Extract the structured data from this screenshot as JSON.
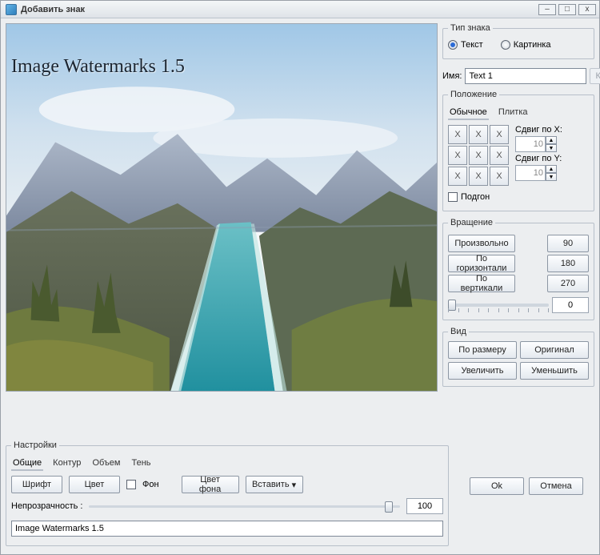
{
  "window": {
    "title": "Добавить знак"
  },
  "preview": {
    "watermark_text": "Image Watermarks 1.5"
  },
  "type": {
    "legend": "Тип знака",
    "text": "Текст",
    "picture": "Картинка",
    "selected": "text"
  },
  "name": {
    "label": "Имя:",
    "value": "Text 1",
    "picture_btn": "Картинка"
  },
  "position": {
    "legend": "Положение",
    "tab_normal": "Обычное",
    "tab_tile": "Плитка",
    "cell": "X",
    "offset_x_label": "Сдвиг по X:",
    "offset_x": "10",
    "offset_y_label": "Сдвиг по Y:",
    "offset_y": "10",
    "fit": "Подгон"
  },
  "rotation": {
    "legend": "Вращение",
    "arbitrary": "Произвольно",
    "r90": "90",
    "horizontal": "По горизонтали",
    "r180": "180",
    "vertical": "По вертикали",
    "r270": "270",
    "slider_value": "0"
  },
  "view": {
    "legend": "Вид",
    "fit": "По размеру",
    "original": "Оригинал",
    "zoom_in": "Увеличить",
    "zoom_out": "Уменьшить"
  },
  "settings": {
    "legend": "Настройки",
    "tab_general": "Общие",
    "tab_contour": "Контур",
    "tab_volume": "Объем",
    "tab_shadow": "Тень",
    "font": "Шрифт",
    "color": "Цвет",
    "bg": "Фон",
    "bg_color": "Цвет фона",
    "insert": "Вставить",
    "opacity_label": "Непрозрачность :",
    "opacity_value": "100",
    "text_value": "Image Watermarks 1.5"
  },
  "actions": {
    "ok": "Ok",
    "cancel": "Отмена"
  }
}
